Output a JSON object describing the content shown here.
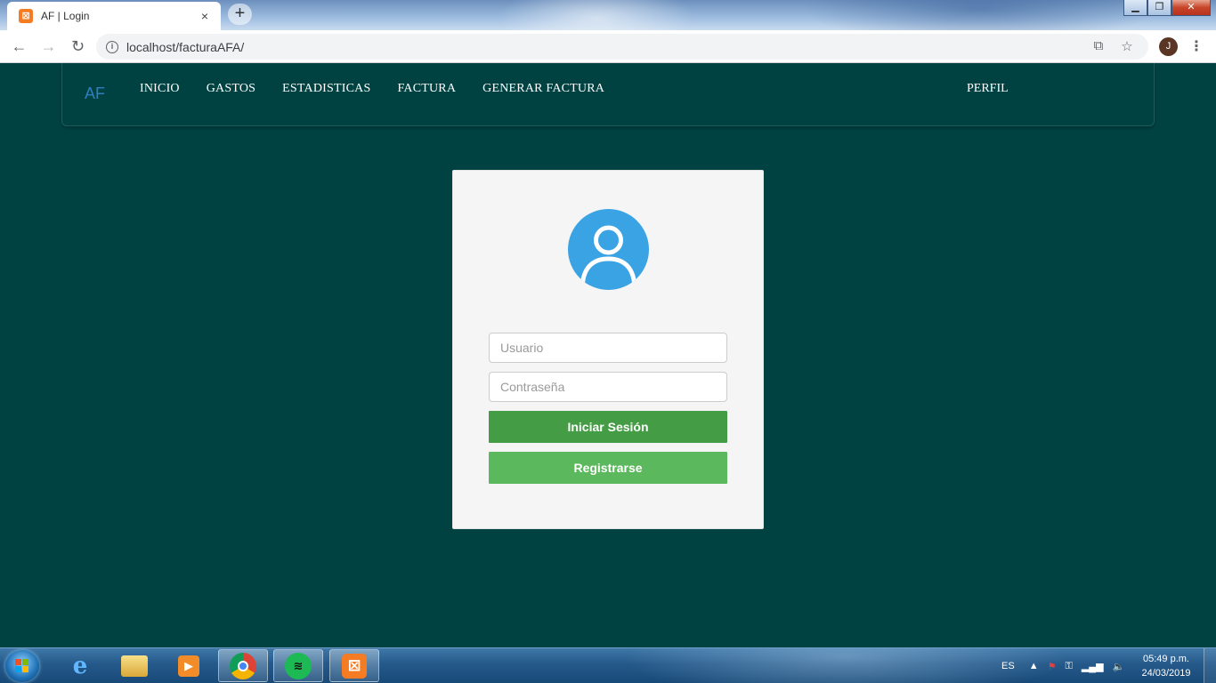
{
  "browser": {
    "tab_title": "AF | Login",
    "tab_favicon": "xampp-icon",
    "tab_close": "×",
    "new_tab": "+",
    "url": "localhost/facturaAFA/",
    "avatar_initial": "J"
  },
  "navbar": {
    "brand": "AF",
    "links": [
      "INICIO",
      "GASTOS",
      "ESTADISTICAS",
      "FACTURA",
      "GENERAR FACTURA"
    ],
    "right_link": "PERFIL"
  },
  "login": {
    "user_placeholder": "Usuario",
    "password_placeholder": "Contraseña",
    "login_button": "Iniciar Sesión",
    "register_button": "Registrarse"
  },
  "taskbar": {
    "language": "ES",
    "time": "05:49 p.m.",
    "date": "24/03/2019"
  },
  "colors": {
    "page_background": "#004242",
    "brand": "#2e7fc0",
    "avatar_circle": "#3aa3e3",
    "login_button": "#449d44",
    "register_button": "#5cb85c"
  }
}
